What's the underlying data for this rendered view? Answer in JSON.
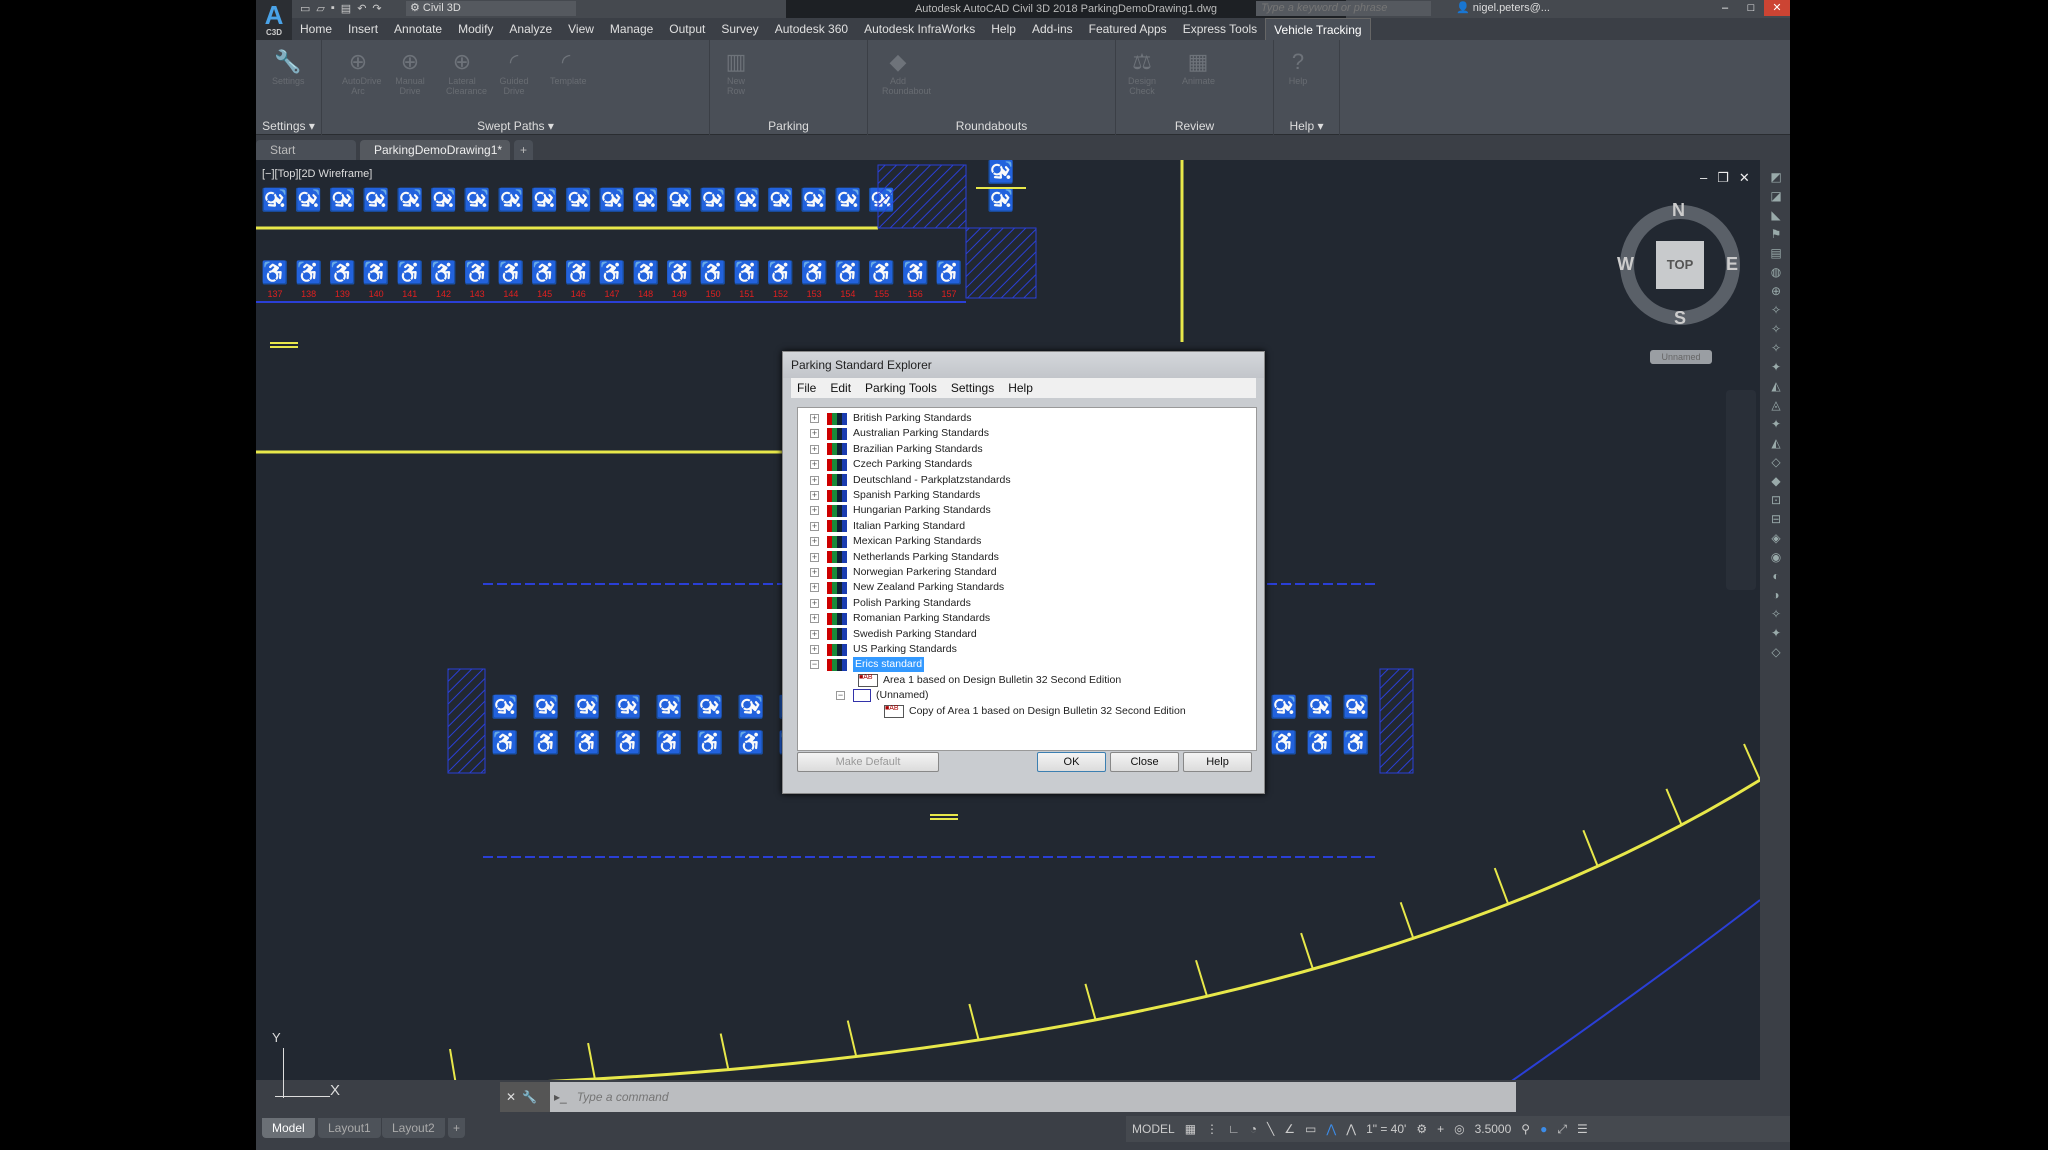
{
  "titlebar": {
    "app_letter": "A",
    "app_badge": "C3D",
    "workspace": "Civil 3D",
    "title": "Autodesk AutoCAD Civil 3D 2018    ParkingDemoDrawing1.dwg",
    "search_placeholder": "Type a keyword or phrase",
    "user": "nigel.peters@..."
  },
  "ribbon_tabs": [
    "Home",
    "Insert",
    "Annotate",
    "Modify",
    "Analyze",
    "View",
    "Manage",
    "Output",
    "Survey",
    "Autodesk 360",
    "Autodesk InfraWorks",
    "Help",
    "Add-ins",
    "Featured Apps",
    "Express Tools",
    "Vehicle Tracking"
  ],
  "active_ribbon_tab": "Vehicle Tracking",
  "ribbon_panels": {
    "settings": {
      "label": "Settings ▾",
      "buttons": [
        "Settings"
      ]
    },
    "swept_paths": {
      "label": "Swept Paths ▾",
      "buttons": [
        "AutoDrive Arc",
        "Manual Drive",
        "Lateral Clearance",
        "Guided Drive",
        "Template"
      ]
    },
    "parking": {
      "label": "Parking",
      "buttons": [
        "New Row"
      ]
    },
    "roundabouts": {
      "label": "Roundabouts",
      "buttons": [
        "Add Roundabout"
      ]
    },
    "review": {
      "label": "Review",
      "buttons": [
        "Design Check",
        "Animate"
      ]
    },
    "help": {
      "label": "Help ▾",
      "buttons": [
        "Help"
      ]
    }
  },
  "doc_tabs": [
    {
      "label": "Start"
    },
    {
      "label": "ParkingDemoDrawing1*"
    }
  ],
  "viewport": {
    "label": "[−][Top][2D Wireframe]",
    "viewcube": {
      "top": "TOP",
      "n": "N",
      "s": "S",
      "e": "E",
      "w": "W"
    },
    "ucs": "Unnamed",
    "ucs_x": "X",
    "ucs_y": "Y"
  },
  "drawing": {
    "stall_numbers": [
      "137",
      "138",
      "139",
      "140",
      "141",
      "142",
      "143",
      "144",
      "145",
      "146",
      "147",
      "148",
      "149",
      "150",
      "151",
      "152",
      "153",
      "154",
      "155",
      "156",
      "157"
    ],
    "accessible_symbol": "♿"
  },
  "dialog": {
    "title": "Parking Standard Explorer",
    "menu": [
      "File",
      "Edit",
      "Parking Tools",
      "Settings",
      "Help"
    ],
    "tree": [
      "British Parking Standards",
      "Australian Parking Standards",
      "Brazilian Parking Standards",
      "Czech Parking Standards",
      "Deutschland - Parkplatzstandards",
      "Spanish Parking Standards",
      "Hungarian Parking Standards",
      "Italian Parking Standard",
      "Mexican Parking Standards",
      "Netherlands Parking Standards",
      "Norwegian Parkering Standard",
      "New Zealand Parking Standards",
      "Polish Parking Standards",
      "Romanian Parking Standards",
      "Swedish Parking Standard",
      "US Parking Standards",
      "Erics standard"
    ],
    "selected": "Erics standard",
    "children": {
      "area1": "Area 1 based on Design Bulletin 32 Second Edition",
      "unnamed": "(Unnamed)",
      "copy": "Copy of Area 1 based on Design Bulletin 32 Second Edition"
    },
    "buttons": {
      "make_default": "Make Default",
      "ok": "OK",
      "close": "Close",
      "help": "Help"
    }
  },
  "command": {
    "placeholder": "Type a command"
  },
  "layout_tabs": [
    "Model",
    "Layout1",
    "Layout2",
    "+"
  ],
  "status": {
    "model": "MODEL",
    "scale": "1\" = 40'",
    "lineweight": "3.5000"
  },
  "colors": {
    "stripe": "#e8e84a",
    "hatch": "#2a3fd6",
    "numbers": "#e02020",
    "bg": "#222831"
  }
}
